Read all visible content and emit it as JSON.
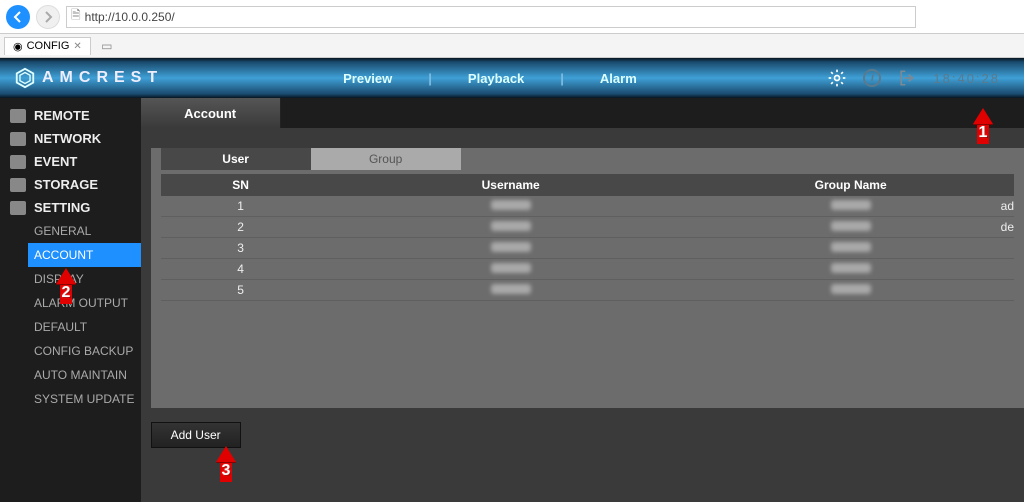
{
  "browser": {
    "url": "http://10.0.0.250/",
    "tab_title": "CONFIG"
  },
  "brand": "AMCREST",
  "top_nav": {
    "preview": "Preview",
    "playback": "Playback",
    "alarm": "Alarm"
  },
  "clock": "18:40:28",
  "sidebar": {
    "main": [
      {
        "label": "REMOTE"
      },
      {
        "label": "NETWORK"
      },
      {
        "label": "EVENT"
      },
      {
        "label": "STORAGE"
      },
      {
        "label": "SETTING"
      }
    ],
    "setting_subs": [
      "GENERAL",
      "ACCOUNT",
      "DISPLAY",
      "ALARM OUTPUT",
      "DEFAULT",
      "CONFIG BACKUP",
      "AUTO MAINTAIN",
      "SYSTEM UPDATE"
    ],
    "active_sub": "ACCOUNT"
  },
  "content": {
    "tab_label": "Account",
    "subtabs": {
      "user": "User",
      "group": "Group"
    },
    "columns": {
      "sn": "SN",
      "username": "Username",
      "group": "Group Name"
    },
    "rows": [
      {
        "sn": "1",
        "extra": "ad"
      },
      {
        "sn": "2",
        "extra": "de"
      },
      {
        "sn": "3",
        "extra": ""
      },
      {
        "sn": "4",
        "extra": ""
      },
      {
        "sn": "5",
        "extra": ""
      }
    ],
    "add_user": "Add User"
  },
  "annotations": {
    "one": "1",
    "two": "2",
    "three": "3"
  }
}
